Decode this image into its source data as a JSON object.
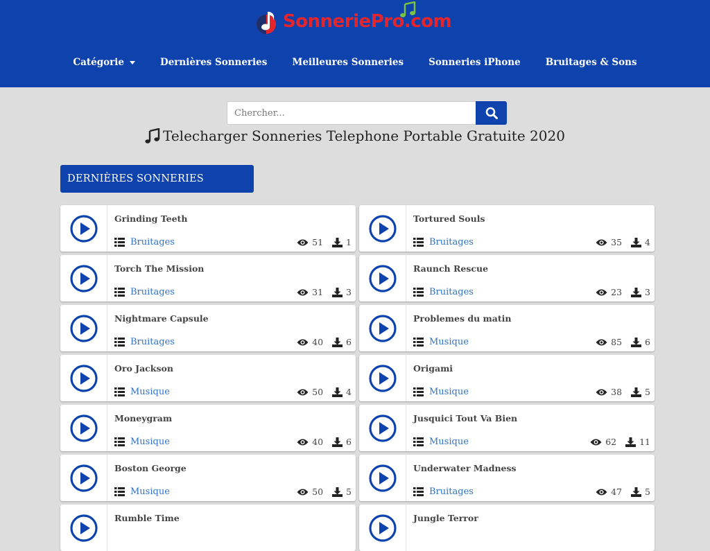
{
  "brand": {
    "name": "SonneriePro.com",
    "icon": "music-note-logo-icon"
  },
  "nav": [
    {
      "label": "Catégorie",
      "dropdown": true
    },
    {
      "label": "Dernières Sonneries"
    },
    {
      "label": "Meilleures Sonneries"
    },
    {
      "label": "Sonneries iPhone"
    },
    {
      "label": "Bruitages & Sons"
    }
  ],
  "search": {
    "placeholder": "Chercher...",
    "value": "",
    "icon": "search-icon"
  },
  "page_title": "Telecharger Sonneries Telephone Portable Gratuite 2020",
  "section_title": "DERNIÈRES SONNERIES",
  "colors": {
    "header": "#0e42ad",
    "accent": "#0e42ad",
    "link": "#2f73c9",
    "logo_red": "#e3262e"
  },
  "items": [
    {
      "name": "Grinding Teeth",
      "category": "Bruitages",
      "views": "51",
      "downloads": "1"
    },
    {
      "name": "Tortured Souls",
      "category": "Bruitages",
      "views": "35",
      "downloads": "4"
    },
    {
      "name": "Torch The Mission",
      "category": "Bruitages",
      "views": "31",
      "downloads": "3"
    },
    {
      "name": "Raunch Rescue",
      "category": "Bruitages",
      "views": "23",
      "downloads": "3"
    },
    {
      "name": "Nightmare Capsule",
      "category": "Bruitages",
      "views": "40",
      "downloads": "6"
    },
    {
      "name": "Problemes du matin",
      "category": "Musique",
      "views": "85",
      "downloads": "6"
    },
    {
      "name": "Oro Jackson",
      "category": "Musique",
      "views": "50",
      "downloads": "4"
    },
    {
      "name": "Origami",
      "category": "Musique",
      "views": "38",
      "downloads": "5"
    },
    {
      "name": "Moneygram",
      "category": "Musique",
      "views": "40",
      "downloads": "6"
    },
    {
      "name": "Jusquici Tout Va Bien",
      "category": "Musique",
      "views": "62",
      "downloads": "11"
    },
    {
      "name": "Boston George",
      "category": "Musique",
      "views": "50",
      "downloads": "5"
    },
    {
      "name": "Underwater Madness",
      "category": "Bruitages",
      "views": "47",
      "downloads": "5"
    },
    {
      "name": "Rumble Time",
      "category": "",
      "views": "",
      "downloads": ""
    },
    {
      "name": "Jungle Terror",
      "category": "",
      "views": "",
      "downloads": ""
    }
  ]
}
